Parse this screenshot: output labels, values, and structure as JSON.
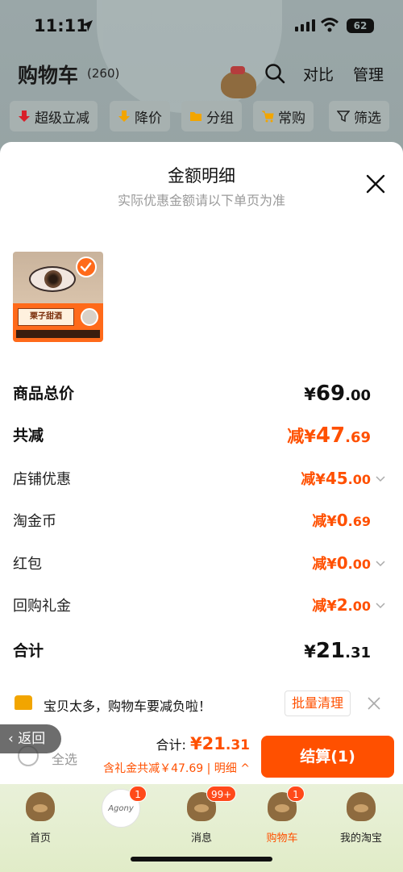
{
  "status_bar": {
    "time": "11:11",
    "battery": "62"
  },
  "header": {
    "title": "购物车",
    "count": "(260)",
    "compare_label": "对比",
    "manage_label": "管理"
  },
  "filters": [
    {
      "label": "超级立减",
      "icon": "price-drop-arrow-icon"
    },
    {
      "label": "降价",
      "icon": "down-arrow-icon"
    },
    {
      "label": "分组",
      "icon": "folder-icon"
    },
    {
      "label": "常购",
      "icon": "cart-icon"
    },
    {
      "label": "筛选",
      "icon": "filter-funnel-icon"
    }
  ],
  "sheet": {
    "title": "金额明细",
    "subtitle": "实际优惠金额请以下单页为准",
    "product": {
      "badge": "栗子甜酒",
      "selected": true
    },
    "rows": [
      {
        "label": "商品总价",
        "prefix": "¥",
        "int": "69",
        "dec": ".00",
        "strong": true,
        "color": "#111111",
        "arrow": false
      },
      {
        "label": "共减",
        "prefix": "减¥",
        "int": "47",
        "dec": ".69",
        "strong": true,
        "color": "#ff5000",
        "arrow": false
      },
      {
        "label": "店铺优惠",
        "prefix": "减¥",
        "int": "45",
        "dec": ".00",
        "strong": false,
        "color": "#ff5000",
        "arrow": true
      },
      {
        "label": "淘金币",
        "prefix": "减¥",
        "int": "0",
        "dec": ".69",
        "strong": false,
        "color": "#ff5000",
        "arrow": false
      },
      {
        "label": "红包",
        "prefix": "减¥",
        "int": "0",
        "dec": ".00",
        "strong": false,
        "color": "#ff5000",
        "arrow": true
      },
      {
        "label": "回购礼金",
        "prefix": "减¥",
        "int": "2",
        "dec": ".00",
        "strong": false,
        "color": "#ff5000",
        "arrow": true
      },
      {
        "label": "合计",
        "prefix": "¥",
        "int": "21",
        "dec": ".31",
        "strong": true,
        "color": "#111111",
        "arrow": false
      }
    ]
  },
  "notice": {
    "text": "宝贝太多，购物车要减负啦！",
    "button": "批量清理"
  },
  "checkout": {
    "back_label": "返回",
    "select_all": "全选",
    "total_prefix": "合计:",
    "total_int": "¥21",
    "total_dec": ".31",
    "savings": "含礼金共减￥47.69 | 明细",
    "button": "结算(1)"
  },
  "tabbar": [
    {
      "label": "首页",
      "badge": ""
    },
    {
      "label": "",
      "badge": "1",
      "avatar_text": "Agony"
    },
    {
      "label": "消息",
      "badge": "99+"
    },
    {
      "label": "购物车",
      "badge": "1",
      "active": true
    },
    {
      "label": "我的淘宝",
      "badge": ""
    }
  ],
  "colors": {
    "accent": "#ff5000",
    "tabbar_bg": "#e5eed0"
  }
}
